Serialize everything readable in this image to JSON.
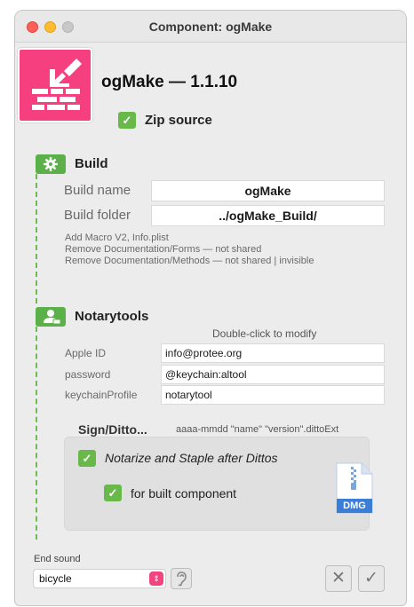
{
  "window": {
    "title": "Component: ogMake"
  },
  "header": {
    "product_name": "ogMake",
    "version": "1.1.10",
    "title_text": "ogMake — 1.1.10",
    "zip_source": {
      "label": "Zip source",
      "checked": true
    }
  },
  "build": {
    "title": "Build",
    "icon": "gear-icon",
    "build_name_label": "Build name",
    "build_name_value": "ogMake",
    "build_folder_label": "Build folder",
    "build_folder_value": "../ogMake_Build/",
    "notes": [
      "Add Macro V2, Info.plist",
      "Remove Documentation/Forms — not shared",
      "Remove Documentation/Methods — not shared | invisible"
    ]
  },
  "notarytools": {
    "title": "Notarytools",
    "icon": "user-badge-icon",
    "hint": "Double-click to modify",
    "apple_id_label": "Apple ID",
    "apple_id_value": "info@protee.org",
    "password_label": "password",
    "password_value": "@keychain:altool",
    "keychain_label": "keychainProfile",
    "keychain_value": "notarytool"
  },
  "sign": {
    "title": "Sign/Ditto...",
    "format_hint": "aaaa-mmdd \"name\" \"version\".dittoExt",
    "notarize": {
      "label": "Notarize and Staple after Dittos",
      "checked": true
    },
    "built_component": {
      "label": "for built component",
      "checked": true
    },
    "dmg_label": "DMG"
  },
  "footer": {
    "end_sound_label": "End sound",
    "end_sound_value": "bicycle",
    "listen_icon": "ear-icon",
    "cancel_icon": "close-icon",
    "ok_icon": "checkmark-icon"
  },
  "colors": {
    "accent_green": "#5cb04a",
    "brand_pink": "#f53f7e"
  }
}
